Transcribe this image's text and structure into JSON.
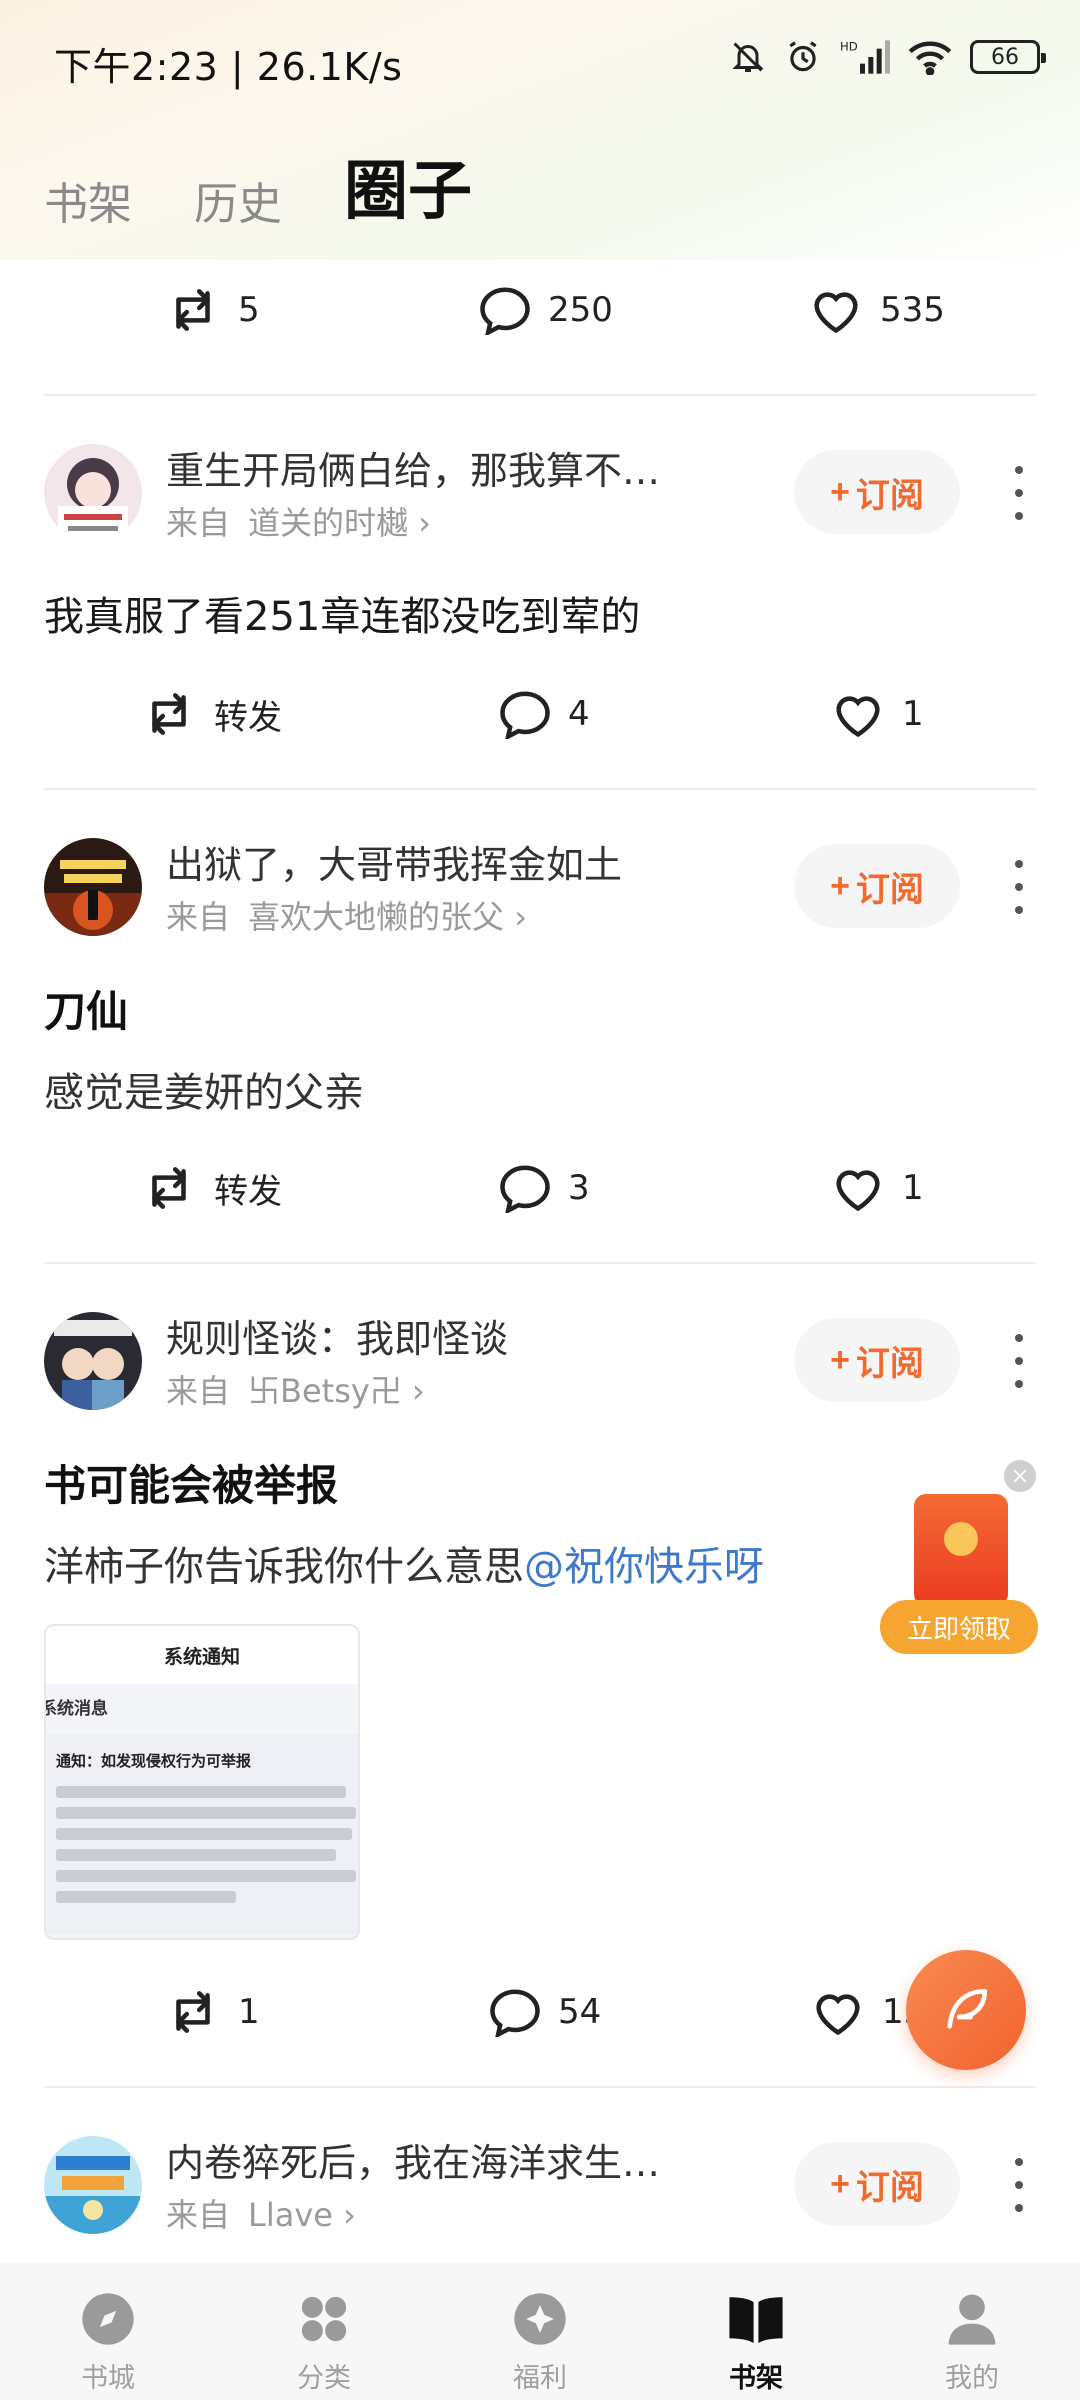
{
  "status_bar": {
    "time": "下午2:23 | 26.1K/s",
    "battery": "66"
  },
  "tabs": [
    {
      "label": "书架"
    },
    {
      "label": "历史"
    },
    {
      "label": "圈子"
    }
  ],
  "top_actions": {
    "repost": "5",
    "comments": "250",
    "likes": "535"
  },
  "posts": [
    {
      "book_title": "重生开局俩白给，那我算不…",
      "from_label": "来自",
      "author": "道关的时樾",
      "subscribe_label": "订阅",
      "text": "我真服了看251章连都没吃到荤的",
      "repost": "转发",
      "comments": "4",
      "likes": "1"
    },
    {
      "book_title": "出狱了，大哥带我挥金如土",
      "from_label": "来自",
      "author": "喜欢大地懒的张父",
      "subscribe_label": "订阅",
      "title": "刀仙",
      "text": "感觉是姜妍的父亲",
      "repost": "转发",
      "comments": "3",
      "likes": "1"
    },
    {
      "book_title": "规则怪谈：我即怪谈",
      "from_label": "来自",
      "author": "卐Betsy卍",
      "subscribe_label": "订阅",
      "title": "书可能会被举报",
      "text": "洋柿子你告诉我你什么意思",
      "mention": "@祝你快乐呀",
      "image": {
        "header": "系统通知",
        "section": "系统消息",
        "notice_title": "通知：如发现侵权行为可举报"
      },
      "repost": "1",
      "comments": "54",
      "likes": "15"
    },
    {
      "book_title": "内卷猝死后，我在海洋求生…",
      "from_label": "来自",
      "author": "Llave",
      "subscribe_label": "订阅"
    }
  ],
  "red_packet": {
    "button": "立即领取"
  },
  "bottom_nav": [
    {
      "label": "书城",
      "icon": "compass-icon"
    },
    {
      "label": "分类",
      "icon": "category-icon"
    },
    {
      "label": "福利",
      "icon": "gift-icon"
    },
    {
      "label": "书架",
      "icon": "bookshelf-icon"
    },
    {
      "label": "我的",
      "icon": "profile-icon"
    }
  ],
  "colors": {
    "accent": "#f26a2e",
    "mention": "#3f79c9",
    "divider": "#ededed"
  }
}
